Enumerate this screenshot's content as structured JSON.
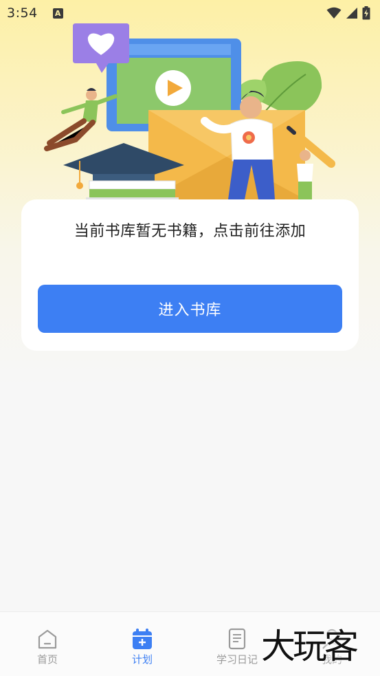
{
  "status_bar": {
    "time": "3:54",
    "notification_icon": "A",
    "icons": [
      "wifi-icon",
      "signal-icon",
      "battery-charging-icon"
    ]
  },
  "empty_state": {
    "message": "当前书库暂无书籍，点击前往添加",
    "button_label": "进入书库"
  },
  "tabs": [
    {
      "label": "首页",
      "icon": "home-icon",
      "active": false
    },
    {
      "label": "计划",
      "icon": "calendar-plus-icon",
      "active": true
    },
    {
      "label": "学习日记",
      "icon": "notebook-icon",
      "active": false
    },
    {
      "label": "我的",
      "icon": "profile-icon",
      "active": false
    }
  ],
  "watermark": "大玩客",
  "colors": {
    "accent": "#3d7ff3",
    "inactive_tab": "#9a9a9a",
    "header_gradient_top": "#fdf0a6"
  }
}
